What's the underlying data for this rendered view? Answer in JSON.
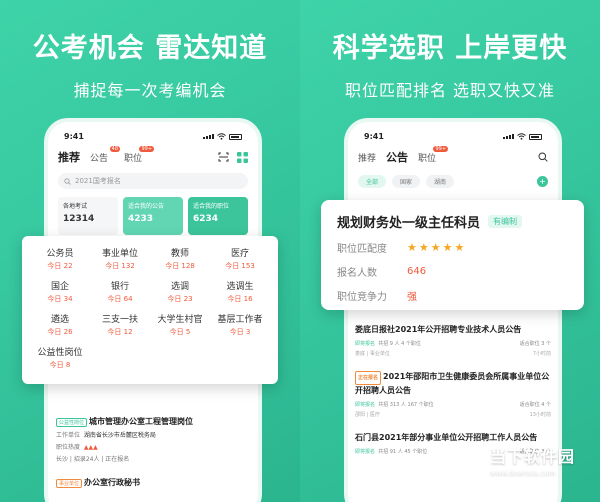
{
  "left": {
    "headline": "公考机会 雷达知道",
    "subline": "捕捉每一次考编机会",
    "phone": {
      "time": "9:41",
      "tabs": [
        {
          "label": "推荐",
          "active": true
        },
        {
          "label": "公告",
          "badge": "48"
        },
        {
          "label": "职位",
          "badge": "99+"
        }
      ],
      "search_placeholder": "2021国考报名",
      "cards": [
        {
          "label": "各地考试",
          "value": "12314"
        },
        {
          "label": "适合我的公告",
          "value": "4233"
        },
        {
          "label": "适合我的职位",
          "value": "6234"
        }
      ]
    },
    "categories": [
      {
        "name": "公务员",
        "count": "今日 22"
      },
      {
        "name": "事业单位",
        "count": "今日 132"
      },
      {
        "name": "教师",
        "count": "今日 128"
      },
      {
        "name": "医疗",
        "count": "今日 153"
      },
      {
        "name": "国企",
        "count": "今日 34"
      },
      {
        "name": "银行",
        "count": "今日 64"
      },
      {
        "name": "选调",
        "count": "今日 23"
      },
      {
        "name": "选调生",
        "count": "今日 16"
      },
      {
        "name": "遴选",
        "count": "今日 26"
      },
      {
        "name": "三支一扶",
        "count": "今日 12"
      },
      {
        "name": "大学生村官",
        "count": "今日 5"
      },
      {
        "name": "基层工作者",
        "count": "今日 3"
      },
      {
        "name": "公益性岗位",
        "count": "今日 8"
      }
    ],
    "listing": {
      "tag": "公益性岗位",
      "title": "城市管理办公室工程管理岗位",
      "unit_label": "工作单位",
      "unit_value": "湖南省长沙市岳麓区税务局",
      "heat_label": "职位热度",
      "meta": "长沙 | 招录24人 | 正在报名",
      "tag2": "事业单位",
      "title2": "办公室行政秘书"
    }
  },
  "right": {
    "headline": "科学选职 上岸更快",
    "subline": "职位匹配排名 选职又快又准",
    "phone": {
      "time": "9:41",
      "tabs": [
        {
          "label": "推荐"
        },
        {
          "label": "公告",
          "active": true
        },
        {
          "label": "职位",
          "badge": "99+"
        }
      ],
      "chips": [
        "全部",
        "国家",
        "湖南"
      ]
    },
    "job": {
      "title": "规划财务处一级主任科员",
      "tag": "有编制",
      "match_label": "职位匹配度",
      "stars": "★★★★★",
      "applicants_label": "报名人数",
      "applicants_value": "646",
      "competition_label": "职位竞争力",
      "competition_value": "强"
    },
    "list": [
      {
        "title": "娄底日报社2021年公开招聘专业技术人员公告",
        "status": "即将报名",
        "count": "共招 9 人 4 个职位",
        "fit": "适合职位 3 个",
        "area": "娄底 | 事业单位",
        "time": "7小时前"
      },
      {
        "tag": "正在报名",
        "title": "2021年邵阳市卫生健康委员会所属事业单位公开招聘人员公告",
        "status": "即将报名",
        "count": "共招 313 人 167 个职位",
        "fit": "适合职位 4 个",
        "area": "邵阳 | 医疗",
        "time": "13小时前"
      },
      {
        "title": "石门县2021年部分事业单位公开招聘工作人员公告",
        "status": "即将报名",
        "count": "共招 91 人 45 个职位",
        "fit": "适合职位 3 个",
        "area": "",
        "time": ""
      }
    ]
  },
  "watermark": {
    "text": "当下软件园",
    "url": "www.downxia.com"
  },
  "colors": {
    "green": "#3cc59b",
    "red": "#f05a3c",
    "star": "#f5a623"
  }
}
